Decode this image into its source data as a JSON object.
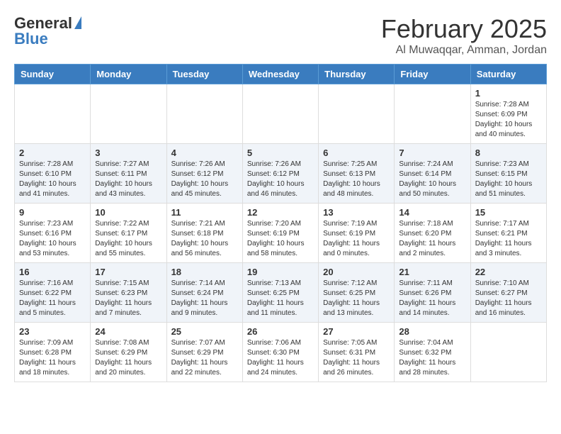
{
  "logo": {
    "general": "General",
    "blue": "Blue"
  },
  "title": "February 2025",
  "location": "Al Muwaqqar, Amman, Jordan",
  "weekdays": [
    "Sunday",
    "Monday",
    "Tuesday",
    "Wednesday",
    "Thursday",
    "Friday",
    "Saturday"
  ],
  "rows": [
    [
      {
        "num": "",
        "info": ""
      },
      {
        "num": "",
        "info": ""
      },
      {
        "num": "",
        "info": ""
      },
      {
        "num": "",
        "info": ""
      },
      {
        "num": "",
        "info": ""
      },
      {
        "num": "",
        "info": ""
      },
      {
        "num": "1",
        "info": "Sunrise: 7:28 AM\nSunset: 6:09 PM\nDaylight: 10 hours\nand 40 minutes."
      }
    ],
    [
      {
        "num": "2",
        "info": "Sunrise: 7:28 AM\nSunset: 6:10 PM\nDaylight: 10 hours\nand 41 minutes."
      },
      {
        "num": "3",
        "info": "Sunrise: 7:27 AM\nSunset: 6:11 PM\nDaylight: 10 hours\nand 43 minutes."
      },
      {
        "num": "4",
        "info": "Sunrise: 7:26 AM\nSunset: 6:12 PM\nDaylight: 10 hours\nand 45 minutes."
      },
      {
        "num": "5",
        "info": "Sunrise: 7:26 AM\nSunset: 6:12 PM\nDaylight: 10 hours\nand 46 minutes."
      },
      {
        "num": "6",
        "info": "Sunrise: 7:25 AM\nSunset: 6:13 PM\nDaylight: 10 hours\nand 48 minutes."
      },
      {
        "num": "7",
        "info": "Sunrise: 7:24 AM\nSunset: 6:14 PM\nDaylight: 10 hours\nand 50 minutes."
      },
      {
        "num": "8",
        "info": "Sunrise: 7:23 AM\nSunset: 6:15 PM\nDaylight: 10 hours\nand 51 minutes."
      }
    ],
    [
      {
        "num": "9",
        "info": "Sunrise: 7:23 AM\nSunset: 6:16 PM\nDaylight: 10 hours\nand 53 minutes."
      },
      {
        "num": "10",
        "info": "Sunrise: 7:22 AM\nSunset: 6:17 PM\nDaylight: 10 hours\nand 55 minutes."
      },
      {
        "num": "11",
        "info": "Sunrise: 7:21 AM\nSunset: 6:18 PM\nDaylight: 10 hours\nand 56 minutes."
      },
      {
        "num": "12",
        "info": "Sunrise: 7:20 AM\nSunset: 6:19 PM\nDaylight: 10 hours\nand 58 minutes."
      },
      {
        "num": "13",
        "info": "Sunrise: 7:19 AM\nSunset: 6:19 PM\nDaylight: 11 hours\nand 0 minutes."
      },
      {
        "num": "14",
        "info": "Sunrise: 7:18 AM\nSunset: 6:20 PM\nDaylight: 11 hours\nand 2 minutes."
      },
      {
        "num": "15",
        "info": "Sunrise: 7:17 AM\nSunset: 6:21 PM\nDaylight: 11 hours\nand 3 minutes."
      }
    ],
    [
      {
        "num": "16",
        "info": "Sunrise: 7:16 AM\nSunset: 6:22 PM\nDaylight: 11 hours\nand 5 minutes."
      },
      {
        "num": "17",
        "info": "Sunrise: 7:15 AM\nSunset: 6:23 PM\nDaylight: 11 hours\nand 7 minutes."
      },
      {
        "num": "18",
        "info": "Sunrise: 7:14 AM\nSunset: 6:24 PM\nDaylight: 11 hours\nand 9 minutes."
      },
      {
        "num": "19",
        "info": "Sunrise: 7:13 AM\nSunset: 6:25 PM\nDaylight: 11 hours\nand 11 minutes."
      },
      {
        "num": "20",
        "info": "Sunrise: 7:12 AM\nSunset: 6:25 PM\nDaylight: 11 hours\nand 13 minutes."
      },
      {
        "num": "21",
        "info": "Sunrise: 7:11 AM\nSunset: 6:26 PM\nDaylight: 11 hours\nand 14 minutes."
      },
      {
        "num": "22",
        "info": "Sunrise: 7:10 AM\nSunset: 6:27 PM\nDaylight: 11 hours\nand 16 minutes."
      }
    ],
    [
      {
        "num": "23",
        "info": "Sunrise: 7:09 AM\nSunset: 6:28 PM\nDaylight: 11 hours\nand 18 minutes."
      },
      {
        "num": "24",
        "info": "Sunrise: 7:08 AM\nSunset: 6:29 PM\nDaylight: 11 hours\nand 20 minutes."
      },
      {
        "num": "25",
        "info": "Sunrise: 7:07 AM\nSunset: 6:29 PM\nDaylight: 11 hours\nand 22 minutes."
      },
      {
        "num": "26",
        "info": "Sunrise: 7:06 AM\nSunset: 6:30 PM\nDaylight: 11 hours\nand 24 minutes."
      },
      {
        "num": "27",
        "info": "Sunrise: 7:05 AM\nSunset: 6:31 PM\nDaylight: 11 hours\nand 26 minutes."
      },
      {
        "num": "28",
        "info": "Sunrise: 7:04 AM\nSunset: 6:32 PM\nDaylight: 11 hours\nand 28 minutes."
      },
      {
        "num": "",
        "info": ""
      }
    ]
  ]
}
